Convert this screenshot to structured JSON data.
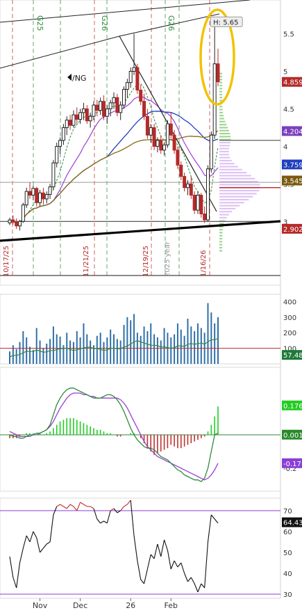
{
  "chart_data": [
    {
      "type": "candlestick",
      "symbol": "/NG",
      "ylim": [
        2.15,
        5.95
      ],
      "yticks": [
        {
          "value": 3,
          "label": "3"
        },
        {
          "value": 3.5,
          "label": "3.5"
        },
        {
          "value": 4,
          "label": "4"
        },
        {
          "value": 4.5,
          "label": "4.5"
        },
        {
          "value": 5,
          "label": "5"
        },
        {
          "value": 5.5,
          "label": "5.5"
        }
      ],
      "price_tags": [
        {
          "label": "4.859",
          "value": 4.859,
          "color": "#b52a2a"
        },
        {
          "label": "4.204",
          "value": 4.204,
          "color": "#7a3fbf"
        },
        {
          "label": "3.759",
          "value": 3.759,
          "color": "#1f3fbf"
        },
        {
          "label": "3.545",
          "value": 3.545,
          "color": "#7a5a10"
        },
        {
          "label": "2.902",
          "value": 2.902,
          "color": "#b52a2a"
        }
      ],
      "high_callout": {
        "label": "H: 5.65",
        "value": 5.65
      },
      "vertical_date_labels": [
        "10/17/25",
        "11/21/25",
        "12/19/25",
        "2025 year",
        "1/16/26"
      ],
      "expiry_labels": [
        "G25",
        "G26",
        "G26"
      ],
      "candles": [
        [
          2.98,
          3.05,
          2.95,
          3.02
        ],
        [
          3.02,
          3.08,
          2.96,
          2.99
        ],
        [
          2.99,
          3.04,
          2.9,
          2.94
        ],
        [
          2.94,
          3.02,
          2.88,
          3.0
        ],
        [
          3.0,
          3.25,
          2.98,
          3.22
        ],
        [
          3.22,
          3.45,
          3.18,
          3.4
        ],
        [
          3.4,
          3.52,
          3.3,
          3.35
        ],
        [
          3.35,
          3.48,
          3.28,
          3.44
        ],
        [
          3.44,
          3.46,
          3.2,
          3.25
        ],
        [
          3.25,
          3.42,
          3.2,
          3.38
        ],
        [
          3.38,
          3.45,
          3.22,
          3.3
        ],
        [
          3.3,
          3.4,
          3.24,
          3.36
        ],
        [
          3.36,
          3.5,
          3.3,
          3.46
        ],
        [
          3.46,
          3.82,
          3.42,
          3.78
        ],
        [
          3.78,
          4.05,
          3.72,
          4.0
        ],
        [
          4.0,
          4.12,
          3.9,
          4.08
        ],
        [
          4.08,
          4.3,
          4.02,
          4.25
        ],
        [
          4.25,
          4.4,
          4.15,
          4.35
        ],
        [
          4.35,
          4.42,
          4.22,
          4.28
        ],
        [
          4.28,
          4.48,
          4.25,
          4.42
        ],
        [
          4.42,
          4.52,
          4.3,
          4.36
        ],
        [
          4.36,
          4.5,
          4.3,
          4.45
        ],
        [
          4.45,
          4.58,
          4.35,
          4.5
        ],
        [
          4.5,
          4.55,
          4.3,
          4.34
        ],
        [
          4.34,
          4.45,
          4.25,
          4.4
        ],
        [
          4.4,
          4.6,
          4.35,
          4.55
        ],
        [
          4.55,
          4.62,
          4.4,
          4.48
        ],
        [
          4.48,
          4.65,
          4.42,
          4.6
        ],
        [
          4.6,
          4.68,
          4.35,
          4.4
        ],
        [
          4.4,
          4.55,
          4.3,
          4.5
        ],
        [
          4.5,
          4.62,
          4.4,
          4.58
        ],
        [
          4.58,
          4.72,
          4.5,
          4.65
        ],
        [
          4.65,
          4.7,
          4.4,
          4.45
        ],
        [
          4.45,
          4.6,
          4.35,
          4.55
        ],
        [
          4.55,
          4.8,
          4.5,
          4.76
        ],
        [
          4.76,
          4.9,
          4.65,
          4.85
        ],
        [
          4.85,
          5.05,
          4.78,
          5.0
        ],
        [
          5.0,
          5.5,
          4.95,
          5.05
        ],
        [
          5.05,
          5.1,
          4.7,
          4.75
        ],
        [
          4.75,
          4.82,
          4.55,
          4.6
        ],
        [
          4.6,
          4.7,
          4.35,
          4.4
        ],
        [
          4.4,
          4.5,
          4.1,
          4.15
        ],
        [
          4.15,
          4.3,
          4.05,
          4.25
        ],
        [
          4.25,
          4.3,
          3.95,
          4.0
        ],
        [
          4.0,
          4.12,
          3.92,
          4.08
        ],
        [
          4.08,
          4.15,
          3.9,
          3.95
        ],
        [
          3.95,
          4.05,
          3.88,
          4.02
        ],
        [
          4.02,
          4.35,
          3.98,
          4.3
        ],
        [
          4.3,
          4.45,
          4.1,
          4.15
        ],
        [
          4.15,
          4.22,
          3.9,
          3.95
        ],
        [
          3.95,
          4.0,
          3.7,
          3.75
        ],
        [
          3.75,
          3.8,
          3.55,
          3.6
        ],
        [
          3.6,
          3.65,
          3.4,
          3.45
        ],
        [
          3.45,
          3.55,
          3.35,
          3.5
        ],
        [
          3.5,
          3.6,
          3.3,
          3.35
        ],
        [
          3.35,
          3.4,
          3.1,
          3.15
        ],
        [
          3.15,
          3.4,
          3.1,
          3.35
        ],
        [
          3.35,
          3.38,
          3.05,
          3.1
        ],
        [
          3.1,
          3.2,
          2.98,
          3.02
        ],
        [
          3.02,
          3.75,
          3.0,
          3.7
        ],
        [
          3.7,
          4.2,
          3.65,
          4.15
        ],
        [
          4.15,
          5.65,
          4.1,
          5.1
        ],
        [
          5.1,
          5.3,
          4.8,
          4.86
        ]
      ],
      "volume_profile_poc": 3.45
    },
    {
      "type": "bar",
      "title": "",
      "ylim": [
        0,
        420
      ],
      "yticks": [
        {
          "value": 100,
          "label": "100"
        },
        {
          "value": 200,
          "label": "200"
        },
        {
          "value": 300,
          "label": "300"
        },
        {
          "value": 400,
          "label": "400"
        }
      ],
      "value_tag": {
        "label": "57.48",
        "value": 57.48
      },
      "reference_line": 100,
      "values": [
        80,
        120,
        95,
        140,
        210,
        170,
        110,
        90,
        230,
        150,
        100,
        130,
        160,
        240,
        190,
        175,
        120,
        200,
        150,
        140,
        210,
        170,
        260,
        190,
        150,
        120,
        180,
        200,
        140,
        170,
        220,
        190,
        160,
        150,
        250,
        300,
        280,
        320,
        200,
        180,
        240,
        210,
        260,
        190,
        170,
        150,
        230,
        200,
        170,
        190,
        260,
        220,
        180,
        290,
        240,
        210,
        260,
        230,
        200,
        390,
        330,
        260,
        300
      ]
    },
    {
      "type": "macd",
      "yticks": [
        {
          "value": -0.2,
          "label": "-0.2"
        }
      ],
      "value_tags": [
        {
          "label": "0.176",
          "value": 0.176,
          "color": "#22cc22"
        },
        {
          "label": "0.001",
          "value": 0.001,
          "color": "#2a8a2a"
        },
        {
          "label": "-0.17",
          "value": -0.17,
          "color": "#8a3fd6"
        }
      ],
      "histogram": [
        -0.02,
        -0.02,
        -0.02,
        -0.01,
        0.0,
        0.01,
        0.01,
        0.01,
        0.0,
        0.01,
        0.0,
        0.01,
        0.02,
        0.04,
        0.06,
        0.08,
        0.09,
        0.1,
        0.1,
        0.1,
        0.09,
        0.08,
        0.07,
        0.06,
        0.05,
        0.04,
        0.03,
        0.03,
        0.02,
        0.01,
        0.01,
        0.0,
        -0.01,
        -0.01,
        0.0,
        0.0,
        0.01,
        0.01,
        0.0,
        -0.02,
        -0.05,
        -0.08,
        -0.1,
        -0.12,
        -0.11,
        -0.1,
        -0.09,
        -0.08,
        -0.06,
        -0.07,
        -0.08,
        -0.08,
        -0.07,
        -0.06,
        -0.05,
        -0.04,
        -0.03,
        -0.02,
        -0.01,
        0.02,
        0.06,
        0.11,
        0.17
      ],
      "macd": [
        0.0,
        -0.01,
        -0.01,
        -0.02,
        -0.02,
        -0.01,
        0.0,
        0.0,
        0.01,
        0.01,
        0.02,
        0.03,
        0.06,
        0.12,
        0.18,
        0.22,
        0.25,
        0.27,
        0.28,
        0.28,
        0.27,
        0.26,
        0.25,
        0.24,
        0.23,
        0.22,
        0.22,
        0.22,
        0.23,
        0.24,
        0.24,
        0.23,
        0.21,
        0.18,
        0.14,
        0.09,
        0.04,
        0.0,
        -0.03,
        -0.05,
        -0.07,
        -0.08,
        -0.08,
        -0.09,
        -0.11,
        -0.13,
        -0.14,
        -0.15,
        -0.17,
        -0.19,
        -0.21,
        -0.22,
        -0.24,
        -0.25,
        -0.26,
        -0.27,
        -0.27,
        -0.28,
        -0.26,
        -0.2,
        -0.1,
        0.0,
        0.01
      ],
      "signal": [
        0.02,
        0.01,
        0.0,
        -0.01,
        -0.01,
        -0.01,
        -0.01,
        0.0,
        0.0,
        0.01,
        0.02,
        0.03,
        0.05,
        0.08,
        0.12,
        0.16,
        0.19,
        0.22,
        0.24,
        0.25,
        0.25,
        0.25,
        0.24,
        0.24,
        0.23,
        0.23,
        0.22,
        0.22,
        0.22,
        0.22,
        0.22,
        0.22,
        0.22,
        0.21,
        0.19,
        0.16,
        0.12,
        0.08,
        0.04,
        0.0,
        -0.04,
        -0.07,
        -0.09,
        -0.11,
        -0.13,
        -0.14,
        -0.15,
        -0.16,
        -0.17,
        -0.18,
        -0.19,
        -0.2,
        -0.21,
        -0.22,
        -0.23,
        -0.24,
        -0.25,
        -0.26,
        -0.27,
        -0.26,
        -0.24,
        -0.21,
        -0.17
      ]
    },
    {
      "type": "line",
      "ylim": [
        28,
        76
      ],
      "yticks": [
        {
          "value": 30,
          "label": "30"
        },
        {
          "value": 40,
          "label": "40"
        },
        {
          "value": 50,
          "label": "50"
        },
        {
          "value": 60,
          "label": "60"
        },
        {
          "value": 70,
          "label": "70"
        }
      ],
      "value_tag": {
        "label": "64.43",
        "value": 64.43
      },
      "levels": [
        70,
        30
      ],
      "values": [
        48,
        38,
        33,
        45,
        52,
        58,
        55,
        60,
        57,
        50,
        52,
        54,
        55,
        68,
        72,
        73,
        72,
        71,
        73,
        72,
        70,
        74,
        73,
        72,
        72,
        71,
        66,
        64,
        65,
        64,
        70,
        71,
        69,
        70,
        72,
        73,
        75,
        58,
        46,
        37,
        35,
        42,
        49,
        47,
        54,
        48,
        56,
        51,
        42,
        46,
        43,
        45,
        40,
        36,
        38,
        35,
        31,
        35,
        33,
        55,
        68,
        66,
        64
      ],
      "xticks": [
        {
          "index": 9,
          "label": "Nov"
        },
        {
          "index": 21,
          "label": "Dec"
        },
        {
          "index": 36,
          "label": "26"
        },
        {
          "index": 48,
          "label": "Feb"
        }
      ]
    }
  ]
}
